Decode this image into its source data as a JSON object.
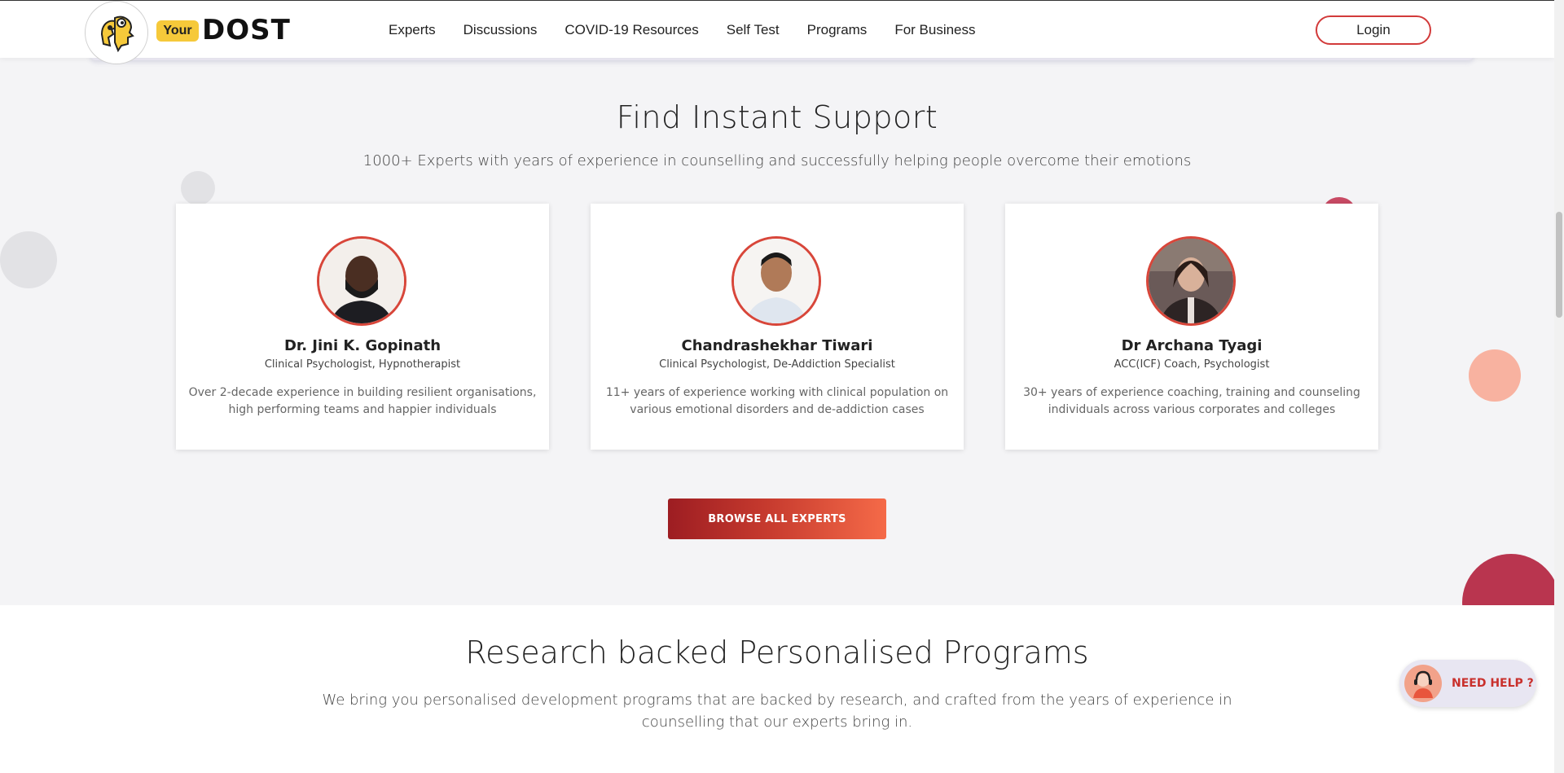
{
  "header": {
    "logo_your": "Your",
    "logo_dost": "DOST",
    "nav": [
      "Experts",
      "Discussions",
      "COVID-19 Resources",
      "Self Test",
      "Programs",
      "For Business"
    ],
    "login_label": "Login"
  },
  "support": {
    "title": "Find Instant Support",
    "subtitle": "1000+ Experts with years of experience in counselling and successfully helping people overcome their emotions",
    "experts": [
      {
        "name": "Dr. Jini K. Gopinath",
        "role": "Clinical Psychologist, Hypnotherapist",
        "desc": "Over 2-decade experience in building resilient organisations, high performing teams and happier individuals"
      },
      {
        "name": "Chandrashekhar Tiwari",
        "role": "Clinical Psychologist, De-Addiction Specialist",
        "desc": "11+ years of experience working with clinical population on various emotional disorders and de-addiction cases"
      },
      {
        "name": "Dr Archana Tyagi",
        "role": "ACC(ICF) Coach, Psychologist",
        "desc": "30+ years of experience coaching, training and counseling individuals across various corporates and colleges"
      }
    ],
    "browse_label": "BROWSE ALL EXPERTS"
  },
  "programs": {
    "title": "Research backed Personalised Programs",
    "desc": "We bring you personalised development programs that are backed by research, and crafted from the years of experience in counselling that our experts bring in."
  },
  "help": {
    "label": "NEED HELP ?"
  },
  "colors": {
    "accent": "#d8463a",
    "button_gradient_start": "#9d1d22",
    "button_gradient_end": "#f56a48",
    "logo_yellow": "#f6c93a"
  }
}
